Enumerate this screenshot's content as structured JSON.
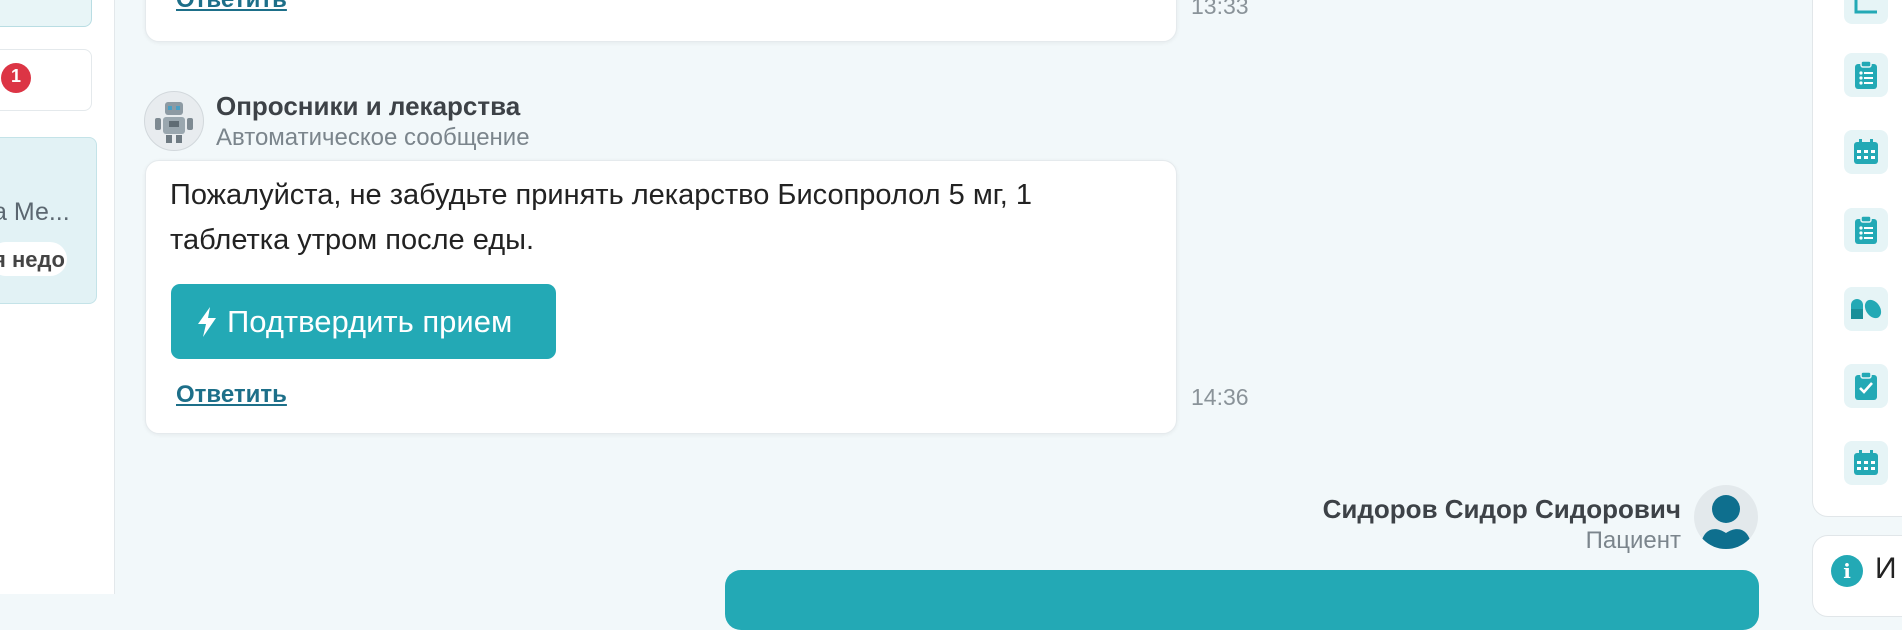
{
  "left_sidebar": {
    "unread_count": "1",
    "chat_preview_name": "а Ме...",
    "chat_preview_text": "я недо"
  },
  "messages": [
    {
      "reply_label": "Ответить",
      "time": "13:33"
    },
    {
      "sender": "Опросники и лекарства",
      "sender_role": "Автоматическое сообщение",
      "text": "Пожалуйста, не забудьте принять лекарство Бисопролол 5 мг, 1 таблетка утром после еды.",
      "action_button": "Подтвердить прием",
      "reply_label": "Ответить",
      "time": "14:36"
    },
    {
      "sender": "Сидоров Сидор Сидорович",
      "sender_role": "Пациент"
    }
  ],
  "right_panel": {
    "tools": [
      "chart-icon",
      "clipboard-list-icon",
      "calendar-icon",
      "clipboard-list-icon",
      "pills-icon",
      "clipboard-check-icon",
      "calendar-icon"
    ],
    "info_label": "И"
  },
  "colors": {
    "accent": "#23a9b5",
    "link": "#1d6f89",
    "badge": "#dc3545",
    "background": "#f2f8fa"
  }
}
